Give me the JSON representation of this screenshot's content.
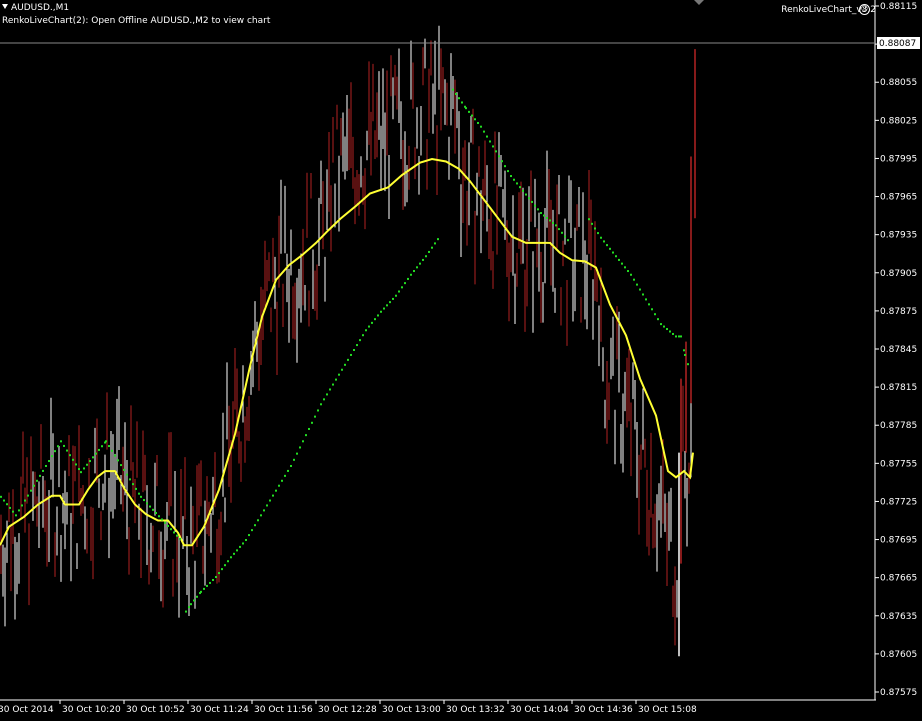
{
  "chart_title": {
    "arrow_icon": "triangle-down-icon",
    "symbol": "AUDUSD.,M1",
    "status": "RenkoLiveChart(2): Open Offline AUDUSD.,M2 to view chart"
  },
  "indicator": {
    "name": "RenkoLiveChart_v3.2",
    "icon": "smiley-icon"
  },
  "colors": {
    "background": "#000000",
    "axis": "#ffffff",
    "bull_bar": "#ffffff",
    "bear_bar": "#b22222",
    "moving_average": "#ffff33",
    "sar_dots": "#22dd22",
    "current_price_box": "#ffffff"
  },
  "chart_data": {
    "type": "line",
    "y_tick_labels": [
      "0.88115",
      "0.88087",
      "0.88055",
      "0.88025",
      "0.87995",
      "0.87965",
      "0.87935",
      "0.87905",
      "0.87875",
      "0.87845",
      "0.87815",
      "0.87785",
      "0.87755",
      "0.87725",
      "0.87695",
      "0.87665",
      "0.87635",
      "0.87605",
      "0.87575"
    ],
    "current_price": "0.88087",
    "x_tick_labels": [
      "30 Oct 2014",
      "30 Oct 10:20",
      "30 Oct 10:52",
      "30 Oct 11:24",
      "30 Oct 11:56",
      "30 Oct 12:28",
      "30 Oct 13:00",
      "30 Oct 13:32",
      "30 Oct 14:04",
      "30 Oct 14:36",
      "30 Oct 15:08"
    ],
    "ylim": [
      0.87566,
      0.88122
    ],
    "grid": false,
    "series": [
      {
        "x": [
          0,
          9,
          24,
          38,
          52,
          60,
          65,
          79,
          88,
          97,
          105,
          115,
          125,
          135,
          146,
          158,
          168,
          178,
          184,
          192,
          204,
          219,
          235,
          250,
          262,
          276,
          289,
          302,
          316,
          328,
          341,
          356,
          370,
          388,
          402,
          420,
          432,
          446,
          459,
          470,
          484,
          498,
          512,
          526,
          540,
          550,
          560,
          572,
          585,
          596,
          610,
          626,
          640,
          656,
          668,
          676,
          684,
          690,
          693
        ],
        "y": [
          0.87685,
          0.877,
          0.87708,
          0.87718,
          0.87725,
          0.87725,
          0.87718,
          0.87718,
          0.8773,
          0.8774,
          0.87745,
          0.87745,
          0.8773,
          0.87718,
          0.8771,
          0.87705,
          0.87705,
          0.87695,
          0.87685,
          0.87685,
          0.877,
          0.8773,
          0.87775,
          0.8783,
          0.8787,
          0.879,
          0.87912,
          0.8792,
          0.8793,
          0.8794,
          0.8795,
          0.8796,
          0.8797,
          0.87975,
          0.87985,
          0.87995,
          0.87998,
          0.87996,
          0.8799,
          0.8798,
          0.87965,
          0.8795,
          0.87935,
          0.8793,
          0.8793,
          0.8793,
          0.87922,
          0.87916,
          0.87915,
          0.8791,
          0.8788,
          0.87855,
          0.8782,
          0.8779,
          0.87745,
          0.8774,
          0.87745,
          0.8774,
          0.8776
        ]
      },
      {
        "x": [
          0,
          15,
          60,
          80,
          105,
          140,
          180,
          185,
          190,
          200,
          215,
          230,
          245,
          260,
          275,
          290,
          305,
          320,
          335,
          350,
          365,
          380,
          395,
          410,
          425,
          438,
          452,
          465,
          480,
          495,
          510,
          525,
          540,
          555,
          570,
          578,
          588,
          600,
          615,
          630,
          645,
          660,
          675,
          680,
          684,
          688
        ],
        "y": [
          0.87725,
          0.8771,
          0.8777,
          0.87745,
          0.8777,
          0.87725,
          0.8769,
          0.87632,
          0.87638,
          0.87648,
          0.8766,
          0.87676,
          0.8769,
          0.8771,
          0.8773,
          0.8775,
          0.87775,
          0.878,
          0.8782,
          0.8784,
          0.8786,
          0.87875,
          0.87888,
          0.87905,
          0.8792,
          0.87935,
          0.88055,
          0.8804,
          0.88025,
          0.88005,
          0.87985,
          0.8797,
          0.87955,
          0.87945,
          0.8793,
          0.87878,
          0.8795,
          0.87935,
          0.8792,
          0.87905,
          0.87885,
          0.87865,
          0.87855,
          0.87855,
          0.8784,
          0.8783
        ]
      }
    ],
    "candles": []
  }
}
